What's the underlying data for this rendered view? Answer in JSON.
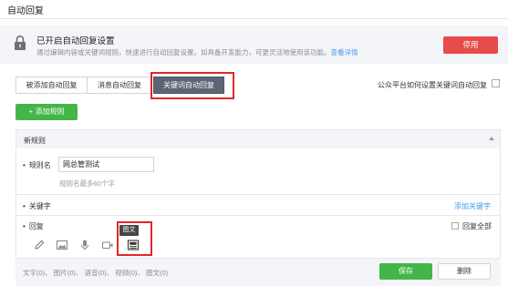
{
  "page": {
    "title": "自动回复"
  },
  "status": {
    "title": "已开启自动回复设置",
    "description": "通过编辑内容或关键词规则，快速进行自动回复设置。如具备开发能力，可更灵活地使用该功能。",
    "link": "查看详情",
    "disable_label": "停用"
  },
  "tabs": [
    {
      "label": "被添加自动回复"
    },
    {
      "label": "消息自动回复"
    },
    {
      "label": "关键词自动回复"
    }
  ],
  "help": {
    "label": "公众平台如何设置关键词自动回复"
  },
  "add_rule_label": "添加规则",
  "rule": {
    "header": "新规则",
    "name_label": "规则名",
    "name_value": "网总管测试",
    "name_hint": "规则名最多60个字",
    "keyword_label": "关键字",
    "add_keyword": "添加关键字",
    "reply_label": "回复",
    "reply_all": "回复全部",
    "tooltip": "图文",
    "counts": "文字(0)、 图片(0)、 语音(0)、 视频(0)、 图文(0)",
    "save_label": "保存",
    "delete_label": "删除"
  },
  "colors": {
    "primary_green": "#44b549",
    "danger_red": "#e74b4b",
    "link_blue": "#459ae9",
    "highlight": "#e3262a",
    "tab_active": "#5a6673"
  },
  "icons": [
    "lock-icon",
    "plus-icon",
    "pencil-icon",
    "image-icon",
    "microphone-icon",
    "video-icon",
    "news-icon",
    "chevron-up-icon"
  ]
}
